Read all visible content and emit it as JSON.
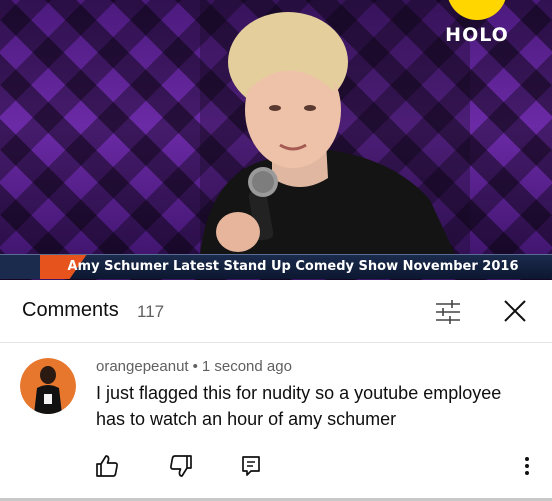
{
  "video": {
    "logo_text": "HOLO",
    "ticker_text": "Amy Schumer Latest Stand Up Comedy Show November 2016",
    "colors": {
      "backdrop": "#5a2196",
      "logo_yellow": "#ffd600",
      "ticker_bg": "#0c1730",
      "ticker_accent": "#e6531d"
    }
  },
  "comments_panel": {
    "title": "Comments",
    "count": "117",
    "sort_icon": "sort-filter-icon",
    "close_icon": "close-icon"
  },
  "comment": {
    "author": "orangepeanut",
    "separator": "•",
    "time": "1 second ago",
    "text": "I just flagged this for nudity so a youtube employee has to watch an hour of amy schumer",
    "avatar_color": "#e8772e",
    "actions": {
      "like_icon": "thumbs-up-icon",
      "dislike_icon": "thumbs-down-icon",
      "reply_icon": "reply-icon",
      "more_icon": "more-vertical-icon"
    }
  }
}
